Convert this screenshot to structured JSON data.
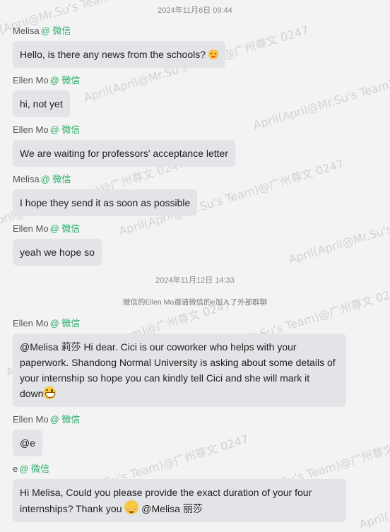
{
  "watermark_text": "April(April@Mr.Su's Team)@广州尊文 0247",
  "timestamps": [
    "2024年11月6日 09:44",
    "2024年11月12日 14:33"
  ],
  "system_notice": "微信的Ellen Mo邀请微信的e加入了外部群聊",
  "messages": [
    {
      "sender": "Melisa",
      "source": "@ 微信",
      "text": "Hello, is there any news from the schools?",
      "emoji": "worried-face-emoji"
    },
    {
      "sender": "Ellen Mo",
      "source": "@ 微信",
      "text": "hi, not yet"
    },
    {
      "sender": "Ellen Mo",
      "source": "@ 微信",
      "text": "We are waiting for professors' acceptance letter"
    },
    {
      "sender": "Melisa",
      "source": "@ 微信",
      "text": "I hope they send it as soon as possible"
    },
    {
      "sender": "Ellen Mo",
      "source": "@ 微信",
      "text": "yeah we hope so"
    },
    {
      "sender": "Ellen Mo",
      "source": "@ 微信",
      "lines": [
        "@Melisa 莉莎 Hi dear. Cici is our coworker who helps with your",
        "paperwork. Shandong Normal University is asking about some details of",
        "your internship so hope you can kindly tell Cici and she will mark it",
        "down"
      ],
      "emoji": "grinning-face-emoji"
    },
    {
      "sender": "Ellen Mo",
      "source": "@ 微信",
      "text": "@e"
    },
    {
      "sender": "e",
      "source": "@ 微信",
      "lines": [
        "Hi Melisa, Could you please provide the exact duration of your four",
        "internships? Thank you"
      ],
      "line2_suffix": "@Melisa 丽莎",
      "emoji": "smiling-face-emoji"
    }
  ]
}
